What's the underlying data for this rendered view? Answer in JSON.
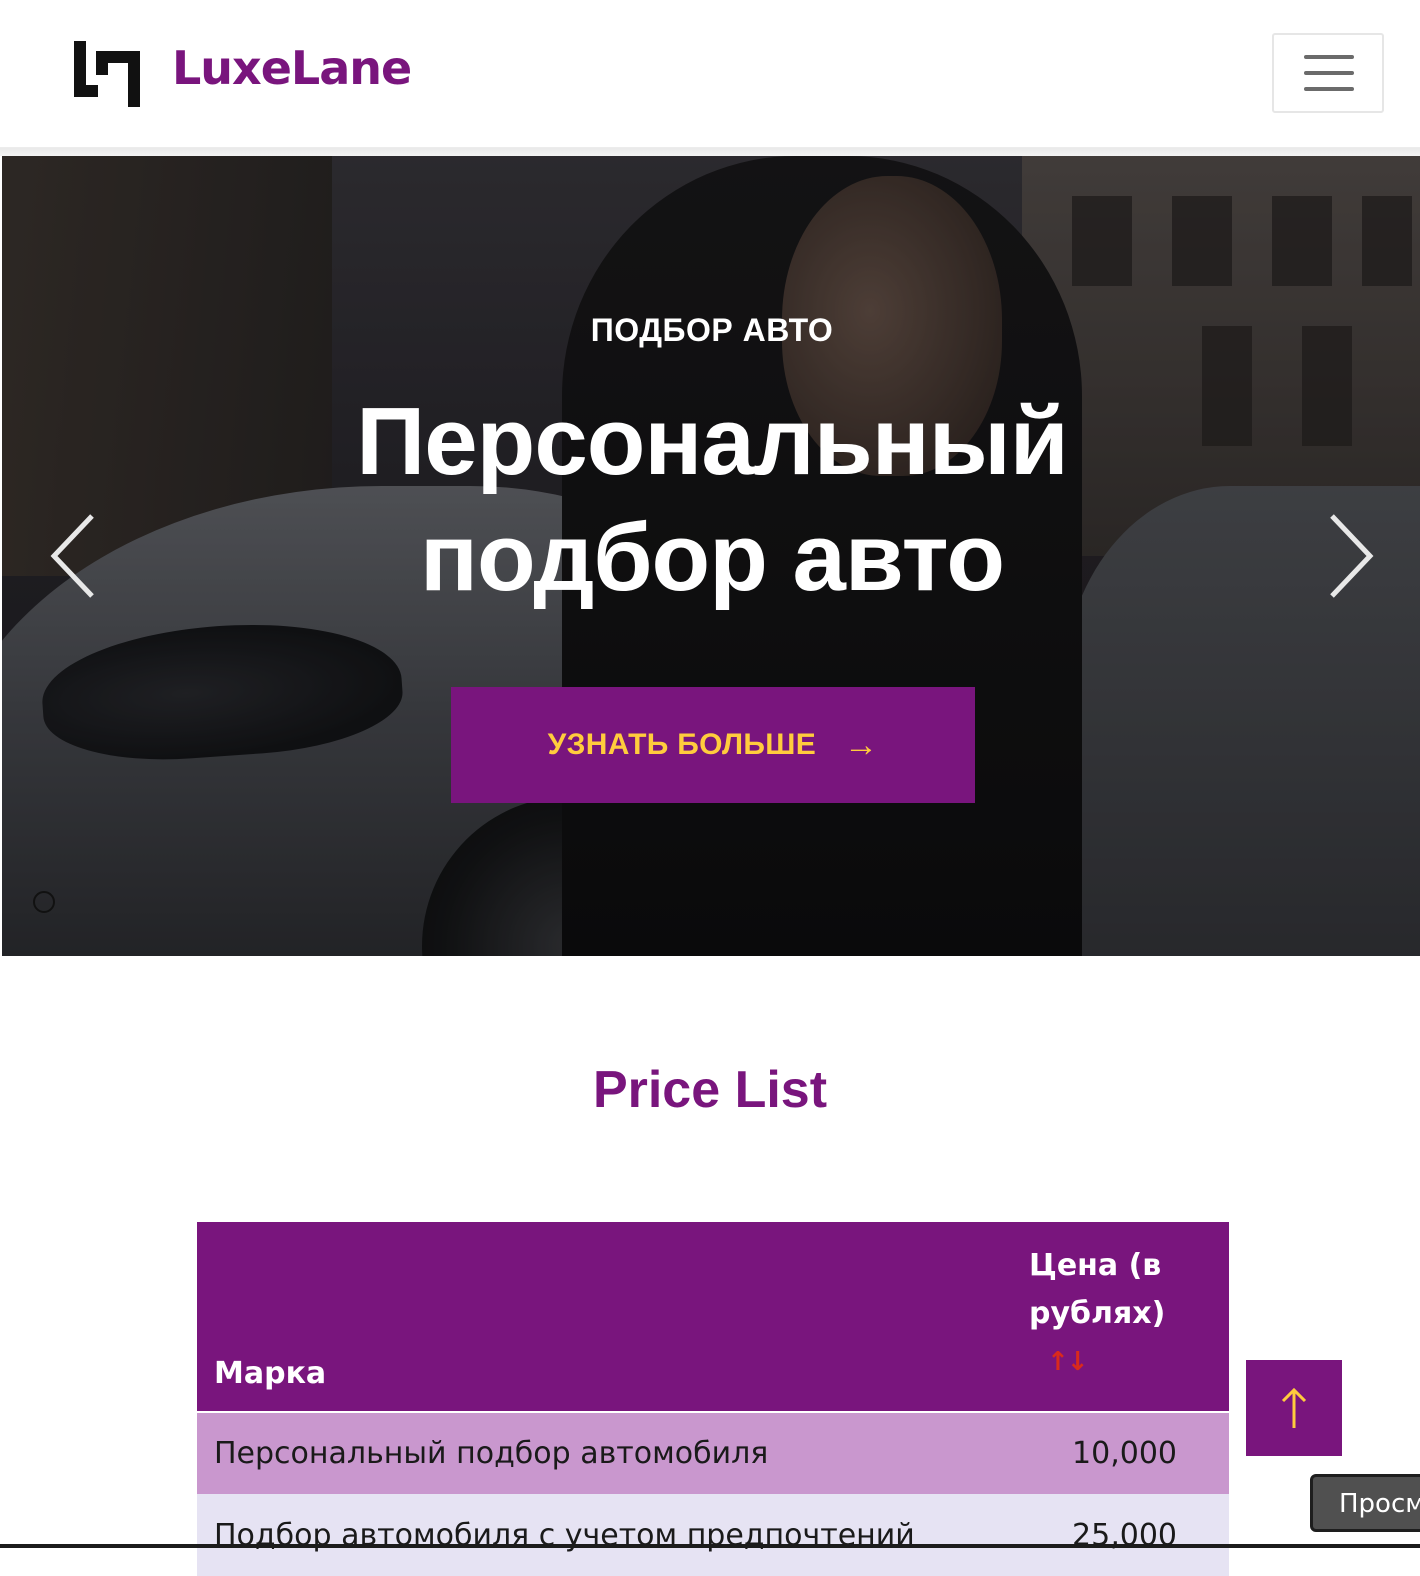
{
  "header": {
    "brand_name": "LuxeLane",
    "logo_icon": "luxelane-logo-icon",
    "menu_icon": "hamburger-menu-icon"
  },
  "hero": {
    "eyebrow": "ПОДБОР АВТО",
    "title_line1": "Персональный",
    "title_line2": "подбор авто",
    "cta_label": "УЗНАТЬ БОЛЬШЕ",
    "cta_icon": "arrow-right-icon",
    "prev_icon": "chevron-left-icon",
    "next_icon": "chevron-right-icon"
  },
  "price_list": {
    "title": "Price List",
    "columns": {
      "brand": "Марка",
      "price": "Цена (в рублях)",
      "sort_icon": "sort-arrows-icon",
      "sort_glyph": "↑↓"
    },
    "rows": [
      {
        "service": "Персональный подбор автомобиля",
        "price": "10,000"
      },
      {
        "service": "Подбор автомобиля с учетом предпочтений",
        "price": "25,000"
      }
    ]
  },
  "floating": {
    "scroll_top_icon": "arrow-up-icon",
    "tooltip_text": "Просм"
  },
  "colors": {
    "brand_purple": "#79157d",
    "accent_yellow": "#ffcc3d",
    "row_odd": "#c997ce",
    "row_even": "#e6e3f3",
    "sort_red": "#d92a1c"
  }
}
